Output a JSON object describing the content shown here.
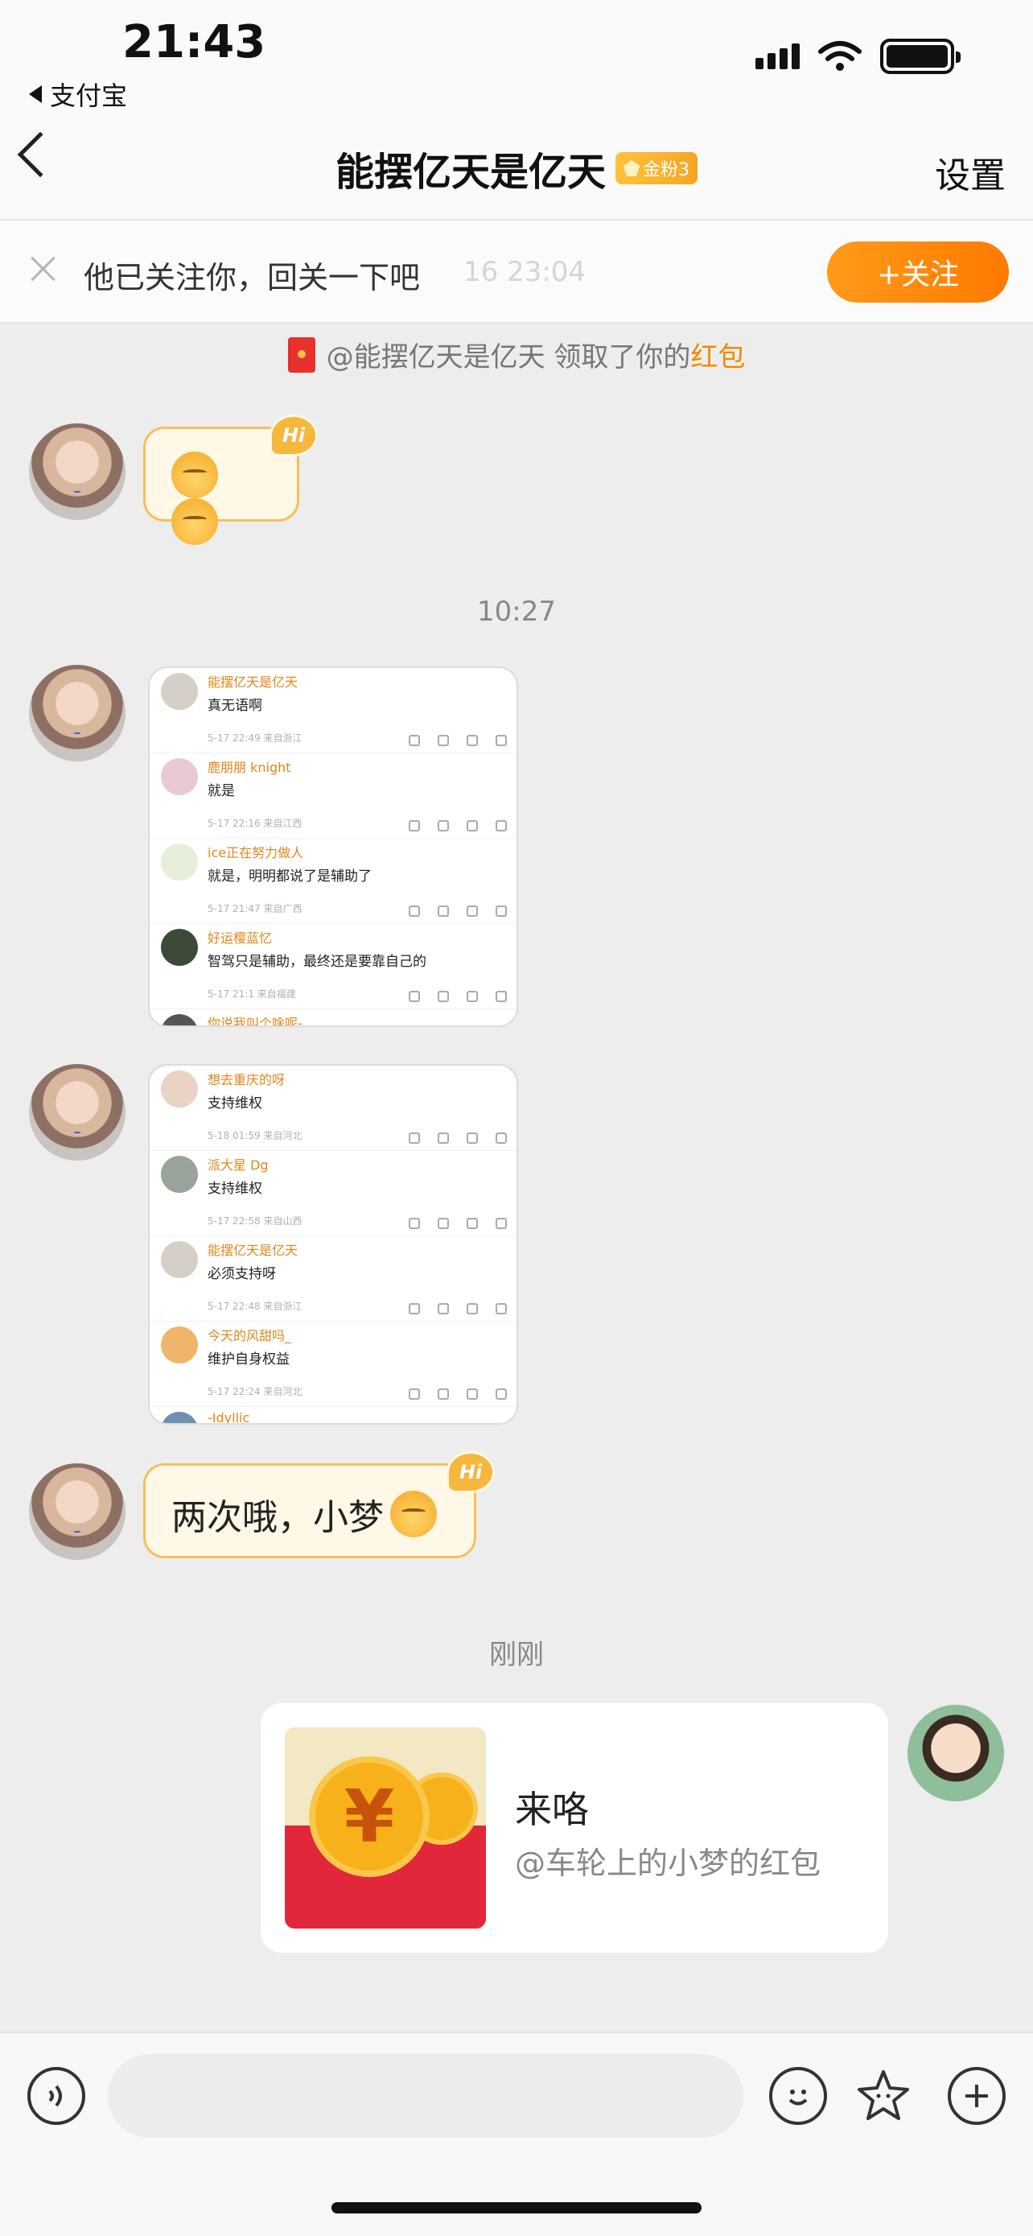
{
  "status_bar": {
    "time": "21:43",
    "back_app": "支付宝"
  },
  "nav": {
    "title": "能摆亿天是亿天",
    "fan_badge": "金粉3",
    "settings": "设置"
  },
  "follow_bar": {
    "text": "他已关注你，回关一下吧",
    "ghost_text": "16 23:04",
    "button": "+关注"
  },
  "messages": {
    "system": {
      "prefix": "@能摆亿天是亿天 领取了你的",
      "highlight": "红包"
    },
    "time_1": "10:27",
    "text_bubble": "两次哦，小梦",
    "time_2": "刚刚",
    "red_packet": {
      "title": "来咯",
      "subtitle": "@车轮上的小梦的红包"
    }
  },
  "screenshot_1": [
    {
      "name": "能摆亿天是亿天",
      "text": "真无语啊",
      "meta": "5-17 22:49 来自浙江"
    },
    {
      "name": "鹿朋朋 knight",
      "text": "就是",
      "meta": "5-17 22:16 来自江西"
    },
    {
      "name": "ice正在努力做人",
      "text": "就是，明明都说了是辅助了",
      "meta": "5-17 21:47 来自广西"
    },
    {
      "name": "好运樱蓝忆",
      "text": "智驾只是辅助，最终还是要靠自己的",
      "meta": "5-17 21:1 来自福建"
    },
    {
      "name": "你说我叫个啥呢-",
      "text": "",
      "meta": ""
    }
  ],
  "screenshot_2": [
    {
      "name": "想去重庆的呀",
      "text": "支持维权",
      "meta": "5-18 01:59 来自河北"
    },
    {
      "name": "派大星 Dg",
      "text": "支持维权",
      "meta": "5-17 22:58 来自山西"
    },
    {
      "name": "能摆亿天是亿天",
      "text": "必须支持呀",
      "meta": "5-17 22:48 来自浙江"
    },
    {
      "name": "今天的风甜吗_",
      "text": "维护自身权益",
      "meta": "5-17 22:24 来自河北"
    },
    {
      "name": "-Idyllic__",
      "text": "",
      "meta": ""
    }
  ],
  "icons": {
    "voice": "voice-icon",
    "emoji": "emoji-icon",
    "sticker": "sticker-icon",
    "add": "plus-icon"
  }
}
